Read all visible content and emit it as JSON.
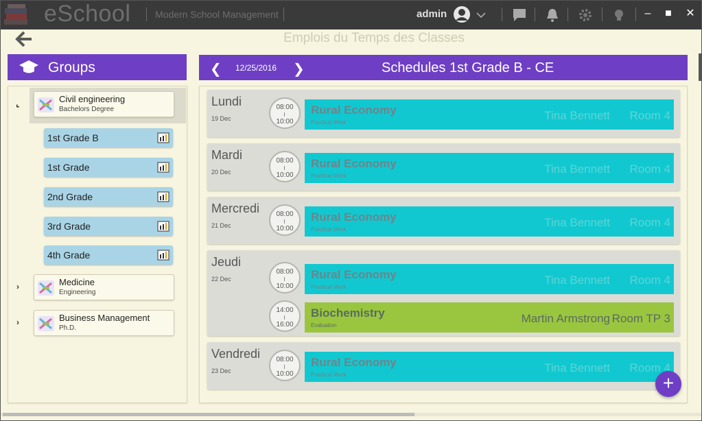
{
  "app": {
    "name": "eSchool",
    "subtitle": "Modern School Management",
    "user": "admin"
  },
  "page": {
    "title": "Emplois du Temps des Classes"
  },
  "groups": {
    "header": "Groups",
    "items": [
      {
        "title": "Civil engineering",
        "subtitle": "Bachelors Degree",
        "expanded": true,
        "classes": [
          "1st Grade B",
          "1st Grade",
          "2nd Grade",
          "3rd Grade",
          "4th Grade"
        ]
      },
      {
        "title": "Medicine",
        "subtitle": "Engineering",
        "expanded": false
      },
      {
        "title": "Business Management",
        "subtitle": "Ph.D.",
        "expanded": false
      }
    ]
  },
  "schedule": {
    "date": "12/25/2016",
    "title": "Schedules 1st Grade B - CE",
    "days": [
      {
        "name": "Lundi",
        "date": "19 Dec",
        "slots": [
          {
            "start": "08:00",
            "end": "10:00",
            "course": "Rural Economy",
            "type": "Practical Work",
            "teacher": "Tina Bennett",
            "room": "Room 4",
            "color": "#11c8d0"
          }
        ]
      },
      {
        "name": "Mardi",
        "date": "20 Dec",
        "slots": [
          {
            "start": "08:00",
            "end": "10:00",
            "course": "Rural Economy",
            "type": "Practical Work",
            "teacher": "Tina Bennett",
            "room": "Room 4",
            "color": "#11c8d0"
          }
        ]
      },
      {
        "name": "Mercredi",
        "date": "21 Dec",
        "slots": [
          {
            "start": "08:00",
            "end": "10:00",
            "course": "Rural Economy",
            "type": "Practical Work",
            "teacher": "Tina Bennett",
            "room": "Room 4",
            "color": "#11c8d0"
          }
        ]
      },
      {
        "name": "Jeudi",
        "date": "22 Dec",
        "slots": [
          {
            "start": "08:00",
            "end": "10:00",
            "course": "Rural Economy",
            "type": "Practical Work",
            "teacher": "Tina Bennett",
            "room": "Room 4",
            "color": "#11c8d0"
          },
          {
            "start": "14:00",
            "end": "16:00",
            "course": "Biochemistry",
            "type": "Evaluation",
            "teacher": "Martin Armstrong",
            "room": "Room TP 3",
            "color": "#9ac63f"
          }
        ]
      },
      {
        "name": "Vendredi",
        "date": "23 Dec",
        "slots": [
          {
            "start": "08:00",
            "end": "10:00",
            "course": "Rural Economy",
            "type": "Practical Work",
            "teacher": "Tina Bennett",
            "room": "Room 4",
            "color": "#11c8d0"
          }
        ]
      }
    ]
  },
  "colors": {
    "accent": "#6e3fc4",
    "background": "#f7f5df",
    "titlebar": "#3a3a3a",
    "class_button": "#a9d4e6"
  },
  "icons": {
    "back": "arrow-left-icon",
    "groups": "graduation-cap-icon",
    "prev": "chevron-left-icon",
    "next": "chevron-right-icon",
    "add": "plus-icon"
  }
}
